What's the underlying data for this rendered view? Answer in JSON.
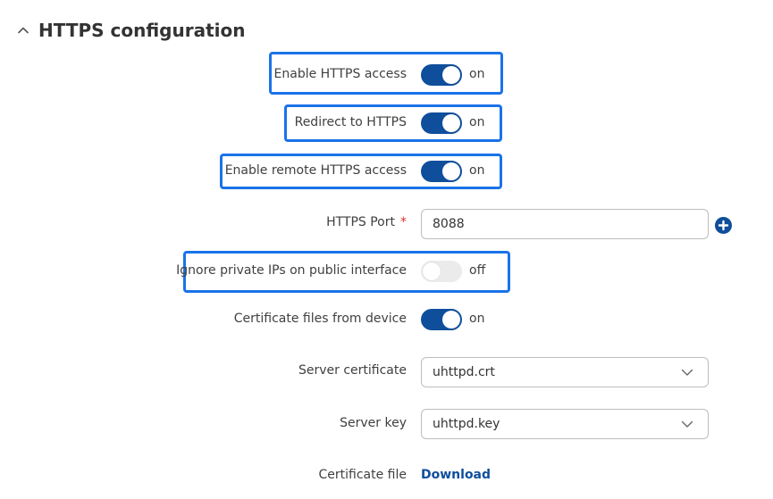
{
  "section": {
    "title": "HTTPS configuration",
    "collapse_icon": "chevron-up-icon"
  },
  "fields": {
    "enable_https": {
      "label": "Enable HTTPS access",
      "state": "on",
      "enabled": true
    },
    "redirect_https": {
      "label": "Redirect to HTTPS",
      "state": "on",
      "enabled": true
    },
    "enable_remote_https": {
      "label": "Enable remote HTTPS access",
      "state": "on",
      "enabled": true
    },
    "https_port": {
      "label": "HTTPS Port",
      "required_marker": "*",
      "value": "8088",
      "add_icon": "plus-circle-icon"
    },
    "ignore_private_ips": {
      "label": "Ignore private IPs on public interface",
      "state": "off",
      "enabled": false
    },
    "cert_from_device": {
      "label": "Certificate files from device",
      "state": "on",
      "enabled": true
    },
    "server_certificate": {
      "label": "Server certificate",
      "value": "uhttpd.crt",
      "icon": "chevron-down-icon"
    },
    "server_key": {
      "label": "Server key",
      "value": "uhttpd.key",
      "icon": "chevron-down-icon"
    },
    "certificate_file": {
      "label": "Certificate file",
      "link": "Download"
    }
  },
  "colors": {
    "accent": "#0f4e9b",
    "highlight": "#1a73e8",
    "required": "#e0312d",
    "toggle_off": "#ebebeb"
  }
}
